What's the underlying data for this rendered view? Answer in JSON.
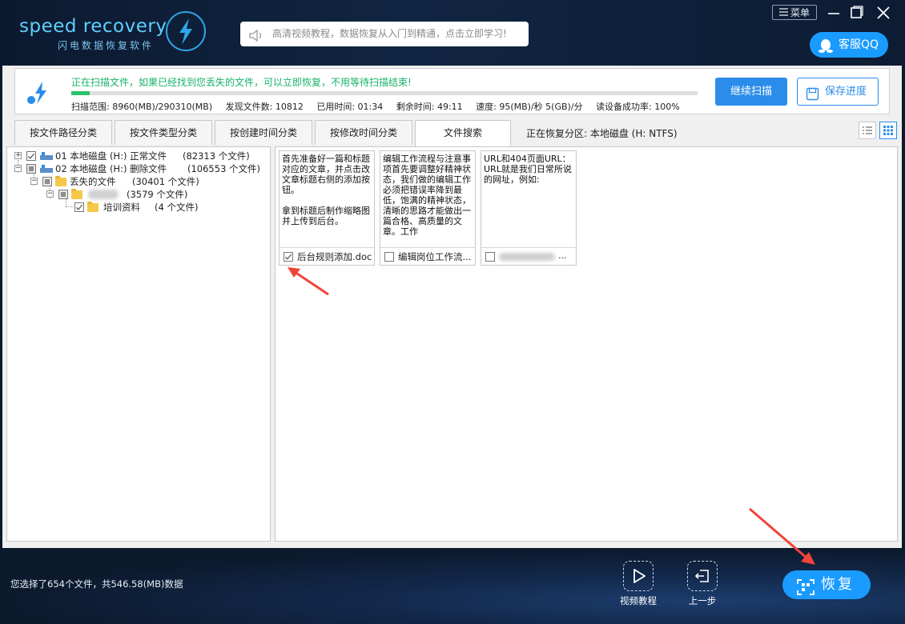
{
  "header": {
    "logo_text": "speed recovery",
    "logo_sub": "闪电数据恢复软件",
    "search_text": "高清视频教程，数据恢复从入门到精通，点击立即学习!",
    "menu_label": "菜单",
    "qq_label": "客服QQ"
  },
  "scan": {
    "message": "正在扫描文件，如果已经找到您丢失的文件，可以立即恢复，不用等待扫描结束!",
    "progress_percent": 3,
    "stats": {
      "range": "扫描范围: 8960(MB)/290310(MB)",
      "found": "发现文件数: 10812",
      "elapsed": "已用时间: 01:34",
      "remaining": "剩余时间: 49:11",
      "speed": "速度: 95(MB)/秒  5(GB)/分",
      "success_rate": "读设备成功率: 100%"
    },
    "continue_label": "继续扫描",
    "save_label": "保存进度"
  },
  "tabs": [
    {
      "label": "按文件路径分类"
    },
    {
      "label": "按文件类型分类"
    },
    {
      "label": "按创建时间分类"
    },
    {
      "label": "按修改时间分类"
    },
    {
      "label": "文件搜索"
    }
  ],
  "partition_text": "正在恢复分区: 本地磁盘 (H: NTFS)",
  "tree": {
    "items": [
      {
        "label": "01 本地磁盘 (H:) 正常文件",
        "count": "(82313 个文件)"
      },
      {
        "label": "02 本地磁盘 (H:) 删除文件",
        "count": "(106553 个文件)"
      },
      {
        "label": "丢失的文件",
        "count": "(30401 个文件)"
      },
      {
        "label": "",
        "count": "(3579 个文件)"
      },
      {
        "label": "培训资料",
        "count": "(4 个文件)"
      }
    ]
  },
  "files": [
    {
      "preview": "首先准备好一篇和标题对应的文章，并点击改文章标题右侧的添加按钮。\n\n拿到标题后制作缩略图并上传到后台。",
      "name": "后台规则添加.doc",
      "checked": true
    },
    {
      "preview": "编辑工作流程与注意事项首先要调整好精神状态，我们做的编辑工作必须把错误率降到最低，饱满的精神状态，清晰的思路才能做出一篇合格、高质量的文章。工作",
      "name": "编辑岗位工作流...",
      "checked": false
    },
    {
      "preview": "URL和404页面URL：URL就是我们日常所说的网址，例如:",
      "name": "",
      "checked": false
    }
  ],
  "footer": {
    "status": "您选择了654个文件，共546.58(MB)数据",
    "video_label": "视频教程",
    "back_label": "上一步",
    "recover_label": "恢复"
  },
  "colors": {
    "accent": "#1a9bff",
    "scan_text": "#17b26a",
    "header_bg": "#0f2240",
    "annotation_arrow": "#f0443a"
  }
}
